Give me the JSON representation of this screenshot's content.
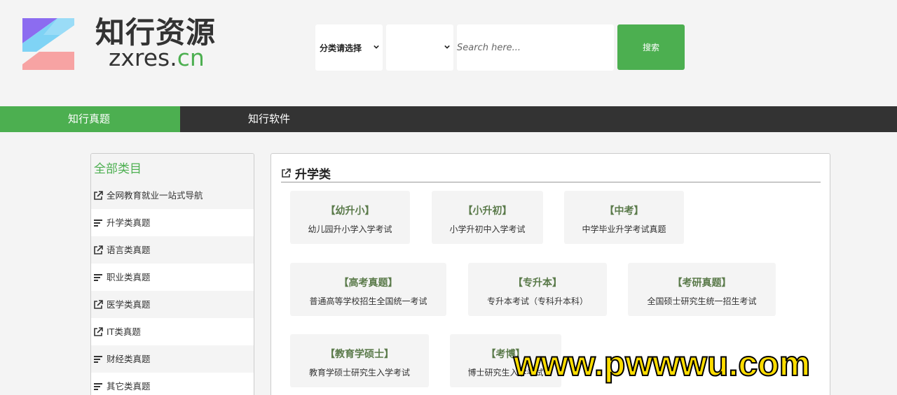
{
  "header": {
    "brand_cn": "知行资源",
    "brand_en_main": "zxres.",
    "brand_en_tld": "cn",
    "category_select": "分类请选择",
    "subcategory_select": "",
    "search_placeholder": "Search here...",
    "search_button": "搜索"
  },
  "nav": {
    "items": [
      {
        "label": "知行真题"
      },
      {
        "label": "知行软件"
      }
    ]
  },
  "sidebar": {
    "title": "全部类目",
    "items": [
      {
        "label": "全网教育就业一站式导航",
        "icon": "external-link-icon"
      },
      {
        "label": "升学类真题",
        "icon": "list-icon"
      },
      {
        "label": "语言类真题",
        "icon": "external-link-icon"
      },
      {
        "label": "职业类真题",
        "icon": "list-icon"
      },
      {
        "label": "医学类真题",
        "icon": "external-link-icon"
      },
      {
        "label": "IT类真题",
        "icon": "external-link-icon"
      },
      {
        "label": "财经类真题",
        "icon": "list-icon"
      },
      {
        "label": "其它类真题",
        "icon": "list-icon"
      }
    ]
  },
  "panel": {
    "title": "升学类",
    "cards": [
      {
        "title": "【幼升小】",
        "desc": "幼儿园升小学入学考试"
      },
      {
        "title": "【小升初】",
        "desc": "小学升初中入学考试"
      },
      {
        "title": "【中考】",
        "desc": "中学毕业升学考试真题"
      },
      {
        "title": "【高考真题】",
        "desc": "普通高等学校招生全国统一考试"
      },
      {
        "title": "【专升本】",
        "desc": "专升本考试（专科升本科）"
      },
      {
        "title": "【考研真题】",
        "desc": "全国硕士研究生统一招生考试"
      },
      {
        "title": "【教育学硕士】",
        "desc": "教育学硕士研究生入学考试"
      },
      {
        "title": "【考博】",
        "desc": "博士研究生入学考试"
      }
    ]
  },
  "watermark": "www.pwwwu.com",
  "colors": {
    "accent": "#4caf50",
    "nav_bg": "#333333",
    "page_bg": "#f4f4f4"
  }
}
